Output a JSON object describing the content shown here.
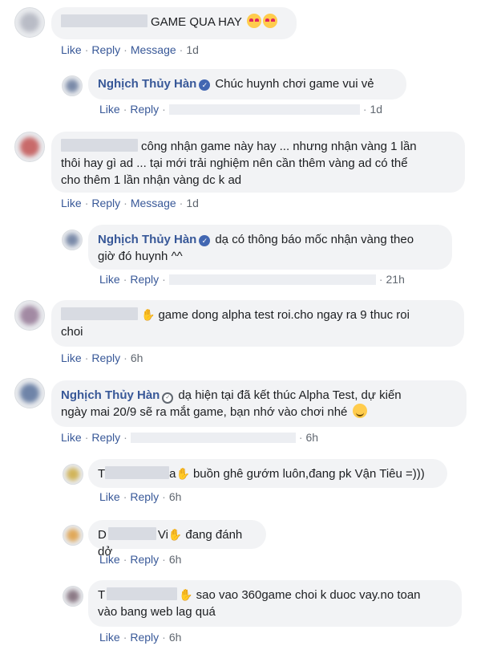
{
  "labels": {
    "like": "Like",
    "reply": "Reply",
    "message": "Message",
    "dot": "·"
  },
  "c1": {
    "text": "GAME QUA HAY",
    "time": "1d"
  },
  "r1": {
    "author": "Nghịch Thủy Hàn",
    "text": "Chúc huynh chơi game vui vẻ",
    "time": "1d"
  },
  "c2": {
    "line1": "công nhận game này hay ... nhưng nhận vàng 1 lần",
    "line2": "thôi hay gì ad ... tại mới trải nghiệm nên cần thêm vàng ad có thể",
    "line3": "cho thêm 1 lần nhận vàng dc k ad",
    "time": "1d"
  },
  "r2": {
    "author": "Nghịch Thủy Hàn",
    "line1": "dạ có thông báo mốc nhận vàng theo",
    "line2": "giờ đó huynh ^^",
    "time": "21h"
  },
  "c3": {
    "line1": "game dong alpha test roi.cho ngay ra 9 thuc roi",
    "line2": "choi",
    "time": "6h"
  },
  "c4": {
    "author": "Nghịch Thủy Hàn",
    "line1": "dạ hiện tại đã kết thúc Alpha Test, dự kiến",
    "line2": "ngày mai 20/9 sẽ ra mắt game, bạn nhớ vào chơi nhé",
    "time": "6h"
  },
  "r3": {
    "prefix": "T",
    "suffix": "a",
    "text": "buồn ghê gướm luôn,đang pk Vận Tiêu =)))",
    "time": "6h"
  },
  "r4": {
    "prefix": "D",
    "suffix": "Vi",
    "text": "đang đánh dở",
    "time": "6h"
  },
  "r5": {
    "prefix": "T",
    "line1": "sao vao 360game choi k duoc vay.no toan",
    "line2": "vào bang web lag quá",
    "time": "6h"
  }
}
